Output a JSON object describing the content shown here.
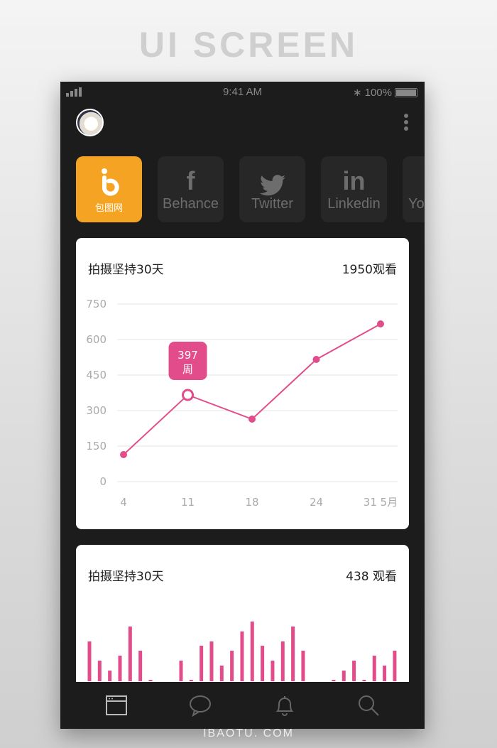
{
  "page_title": "UI SCREEN",
  "footer": "IBAOTU. COM",
  "status": {
    "time": "9:41 AM",
    "battery": "100%"
  },
  "tabs": [
    {
      "label": "包图网",
      "icon": "baotu-logo-icon",
      "active": true
    },
    {
      "label": "Behance",
      "icon": "f"
    },
    {
      "label": "Twitter",
      "icon": "twitter-bird-icon"
    },
    {
      "label": "Linkedin",
      "icon": "in"
    },
    {
      "label": "You",
      "icon": "youtube-icon"
    }
  ],
  "card1": {
    "title": "拍摄坚持30天",
    "value": "1950观看"
  },
  "card2": {
    "title": "拍摄坚持30天",
    "value": "438 观看"
  },
  "colors": {
    "accent": "#e24c8a",
    "orange": "#f5a323"
  },
  "chart_data": [
    {
      "type": "line",
      "categories": [
        "4",
        "11",
        "18",
        "24",
        "31 5月"
      ],
      "values": [
        114,
        366,
        264,
        516,
        666
      ],
      "ylim": [
        0,
        750
      ],
      "yticks": [
        "0",
        "150",
        "300",
        "450",
        "600",
        "750"
      ],
      "grid": true,
      "tooltip": {
        "value": "397",
        "unit": "周",
        "index": 1
      }
    },
    {
      "type": "bar",
      "values": [
        56,
        29,
        15,
        36,
        77,
        43,
        2,
        0,
        0,
        29,
        2,
        50,
        56,
        22,
        43,
        70,
        84,
        50,
        29,
        56,
        77,
        43,
        0,
        0,
        2,
        15,
        29,
        2,
        36,
        22,
        43
      ]
    }
  ],
  "nav": [
    {
      "icon": "browser-window-icon",
      "active": true
    },
    {
      "icon": "chat-bubble-icon"
    },
    {
      "icon": "bell-icon"
    },
    {
      "icon": "search-icon"
    }
  ]
}
